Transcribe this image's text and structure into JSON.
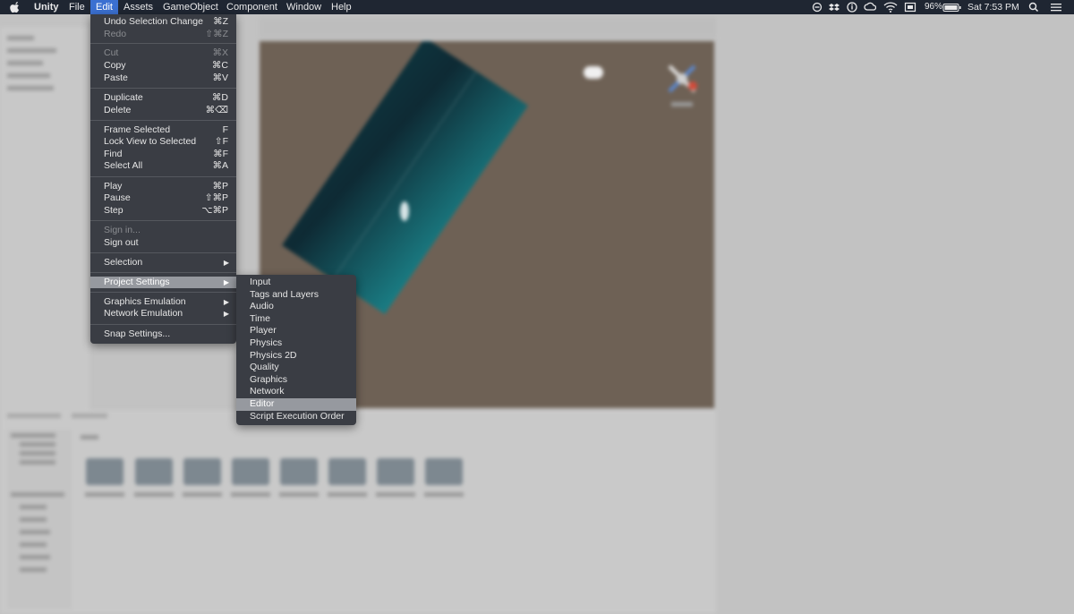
{
  "menubar": {
    "app": "Unity",
    "menus": [
      "File",
      "Edit",
      "Assets",
      "GameObject",
      "Component",
      "Window",
      "Help"
    ],
    "battery": "96%",
    "clock": "Sat 7:53 PM"
  },
  "edit_menu": {
    "items": [
      {
        "label": "Undo Selection Change",
        "shortcut": "⌘Z"
      },
      {
        "label": "Redo",
        "shortcut": "⇧⌘Z"
      },
      {
        "label": "Cut",
        "shortcut": "⌘X"
      },
      {
        "label": "Copy",
        "shortcut": "⌘C"
      },
      {
        "label": "Paste",
        "shortcut": "⌘V"
      },
      {
        "label": "Duplicate",
        "shortcut": "⌘D"
      },
      {
        "label": "Delete",
        "shortcut": "⌘⌫"
      },
      {
        "label": "Frame Selected",
        "shortcut": "F"
      },
      {
        "label": "Lock View to Selected",
        "shortcut": "⇧F"
      },
      {
        "label": "Find",
        "shortcut": "⌘F"
      },
      {
        "label": "Select All",
        "shortcut": "⌘A"
      },
      {
        "label": "Play",
        "shortcut": "⌘P"
      },
      {
        "label": "Pause",
        "shortcut": "⇧⌘P"
      },
      {
        "label": "Step",
        "shortcut": "⌥⌘P"
      },
      {
        "label": "Sign in..."
      },
      {
        "label": "Sign out"
      },
      {
        "label": "Selection"
      },
      {
        "label": "Project Settings"
      },
      {
        "label": "Graphics Emulation"
      },
      {
        "label": "Network Emulation"
      },
      {
        "label": "Snap Settings..."
      }
    ]
  },
  "project_settings_menu": {
    "items": [
      "Input",
      "Tags and Layers",
      "Audio",
      "Time",
      "Player",
      "Physics",
      "Physics 2D",
      "Quality",
      "Graphics",
      "Network",
      "Editor",
      "Script Execution Order"
    ]
  },
  "icons": {
    "apple": "apple-icon",
    "status": [
      "do-not-disturb-icon",
      "dropbox-icon",
      "info-icon",
      "creative-cloud-icon",
      "wifi-icon",
      "display-icon",
      "battery-icon",
      "search-icon",
      "menu-list-icon"
    ]
  },
  "colors": {
    "menubar": "#1f2632",
    "menu_bg": "#3a3d44",
    "active_menu": "#3b70d1",
    "highlight": "#96999f"
  }
}
